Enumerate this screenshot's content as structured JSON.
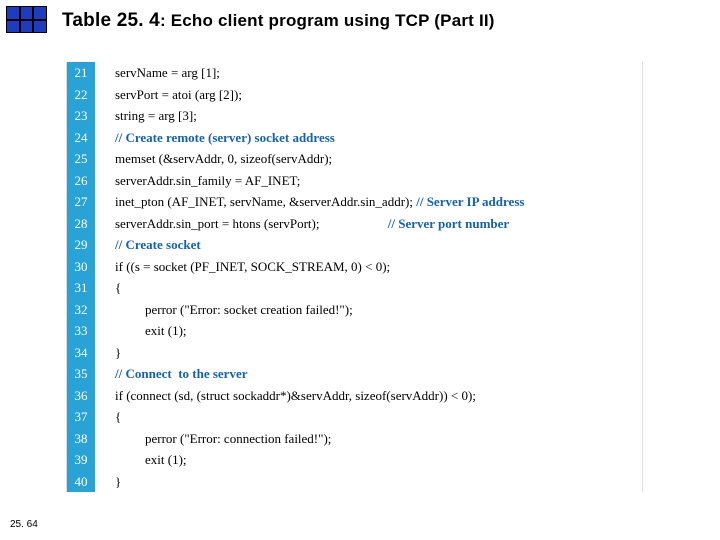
{
  "title": {
    "prefix": "Table 25. 4",
    "suffix": ": Echo client program using TCP (Part II)"
  },
  "footer": "25. 64",
  "lines": [
    {
      "n": "21",
      "indent": 0,
      "text": "servName = arg [1];",
      "comment": false,
      "trail": ""
    },
    {
      "n": "22",
      "indent": 0,
      "text": "servPort = atoi (arg [2]);",
      "comment": false,
      "trail": ""
    },
    {
      "n": "23",
      "indent": 0,
      "text": "string = arg [3];",
      "comment": false,
      "trail": ""
    },
    {
      "n": "24",
      "indent": 0,
      "text": "// Create remote (server) socket address",
      "comment": true,
      "trail": ""
    },
    {
      "n": "25",
      "indent": 0,
      "text": "memset (&servAddr, 0, sizeof(servAddr);",
      "comment": false,
      "trail": ""
    },
    {
      "n": "26",
      "indent": 0,
      "text": "serverAddr.sin_family = AF_INET;",
      "comment": false,
      "trail": ""
    },
    {
      "n": "27",
      "indent": 0,
      "text": "inet_pton (AF_INET, servName, &serverAddr.sin_addr);",
      "comment": false,
      "trail": " // Server IP address"
    },
    {
      "n": "28",
      "indent": 0,
      "text": "serverAddr.sin_port = htons (servPort);",
      "comment": false,
      "trail": "                     // Server port number"
    },
    {
      "n": "29",
      "indent": 0,
      "text": "// Create socket",
      "comment": true,
      "trail": ""
    },
    {
      "n": "30",
      "indent": 0,
      "text": "if ((s = socket (PF_INET, SOCK_STREAM, 0) < 0);",
      "comment": false,
      "trail": ""
    },
    {
      "n": "31",
      "indent": 0,
      "text": "{",
      "comment": false,
      "trail": ""
    },
    {
      "n": "32",
      "indent": 1,
      "text": "perror (\"Error: socket creation failed!\");",
      "comment": false,
      "trail": ""
    },
    {
      "n": "33",
      "indent": 1,
      "text": "exit (1);",
      "comment": false,
      "trail": ""
    },
    {
      "n": "34",
      "indent": 0,
      "text": "}",
      "comment": false,
      "trail": ""
    },
    {
      "n": "35",
      "indent": 0,
      "text": "// Connect  to the server",
      "comment": true,
      "trail": ""
    },
    {
      "n": "36",
      "indent": 0,
      "text": "if (connect (sd, (struct sockaddr*)&servAddr, sizeof(servAddr)) < 0);",
      "comment": false,
      "trail": ""
    },
    {
      "n": "37",
      "indent": 0,
      "text": "{",
      "comment": false,
      "trail": ""
    },
    {
      "n": "38",
      "indent": 1,
      "text": "perror (\"Error: connection failed!\");",
      "comment": false,
      "trail": ""
    },
    {
      "n": "39",
      "indent": 1,
      "text": "exit (1);",
      "comment": false,
      "trail": ""
    },
    {
      "n": "40",
      "indent": 0,
      "text": "}",
      "comment": false,
      "trail": ""
    }
  ]
}
